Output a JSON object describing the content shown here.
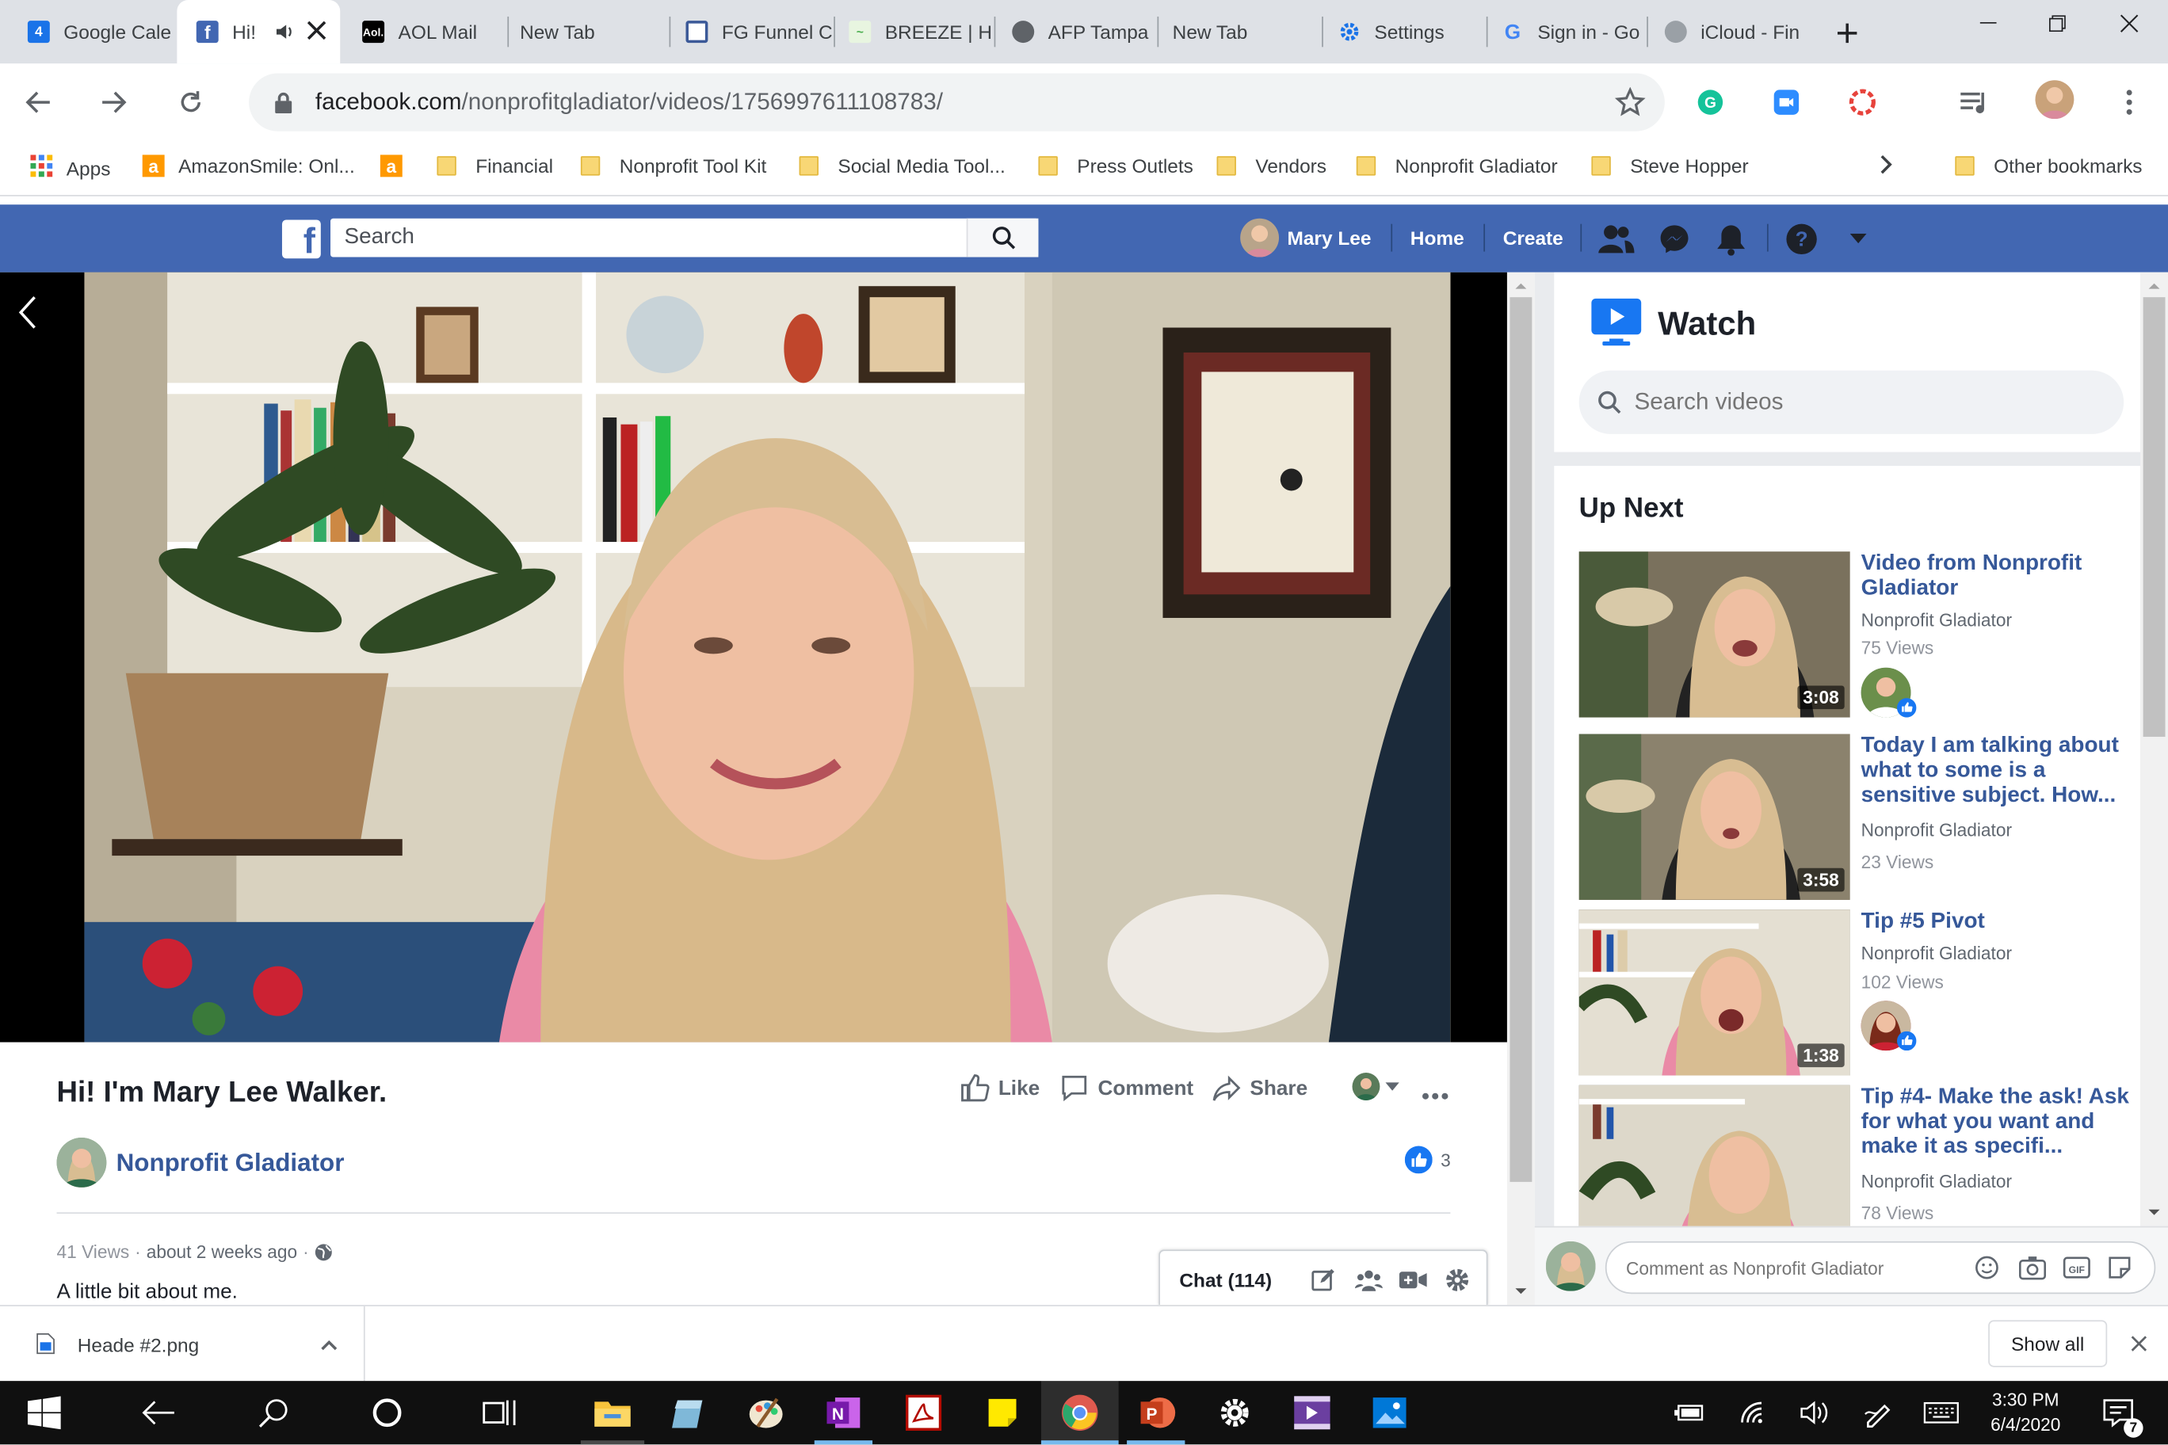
{
  "browser": {
    "tabs": [
      {
        "title": "Google Cale",
        "favicon": "google-calendar-icon"
      },
      {
        "title": "Hi!",
        "favicon": "facebook-icon",
        "active": true
      },
      {
        "title": "AOL Mail",
        "favicon": "aol-icon"
      },
      {
        "title": "New Tab",
        "favicon": ""
      },
      {
        "title": "FG Funnel C",
        "favicon": "funnel-icon"
      },
      {
        "title": "BREEZE | Hc",
        "favicon": "breeze-icon"
      },
      {
        "title": "AFP Tampa",
        "favicon": "globe-icon"
      },
      {
        "title": "New Tab",
        "favicon": ""
      },
      {
        "title": "Settings",
        "favicon": "gear-icon"
      },
      {
        "title": "Sign in - Go",
        "favicon": "google-icon"
      },
      {
        "title": "iCloud - Fin",
        "favicon": "apple-icon"
      }
    ],
    "url_host": "facebook.com",
    "url_path": "/nonprofitgladiator/videos/1756997611108783/",
    "bookmarks": [
      {
        "label": "Apps"
      },
      {
        "label": "AmazonSmile: Onl..."
      },
      {
        "label": ""
      },
      {
        "label": "Financial"
      },
      {
        "label": "Nonprofit Tool Kit"
      },
      {
        "label": "Social Media Tool..."
      },
      {
        "label": "Press Outlets"
      },
      {
        "label": "Vendors"
      },
      {
        "label": "Nonprofit Gladiator"
      },
      {
        "label": "Steve Hopper"
      }
    ],
    "other_bookmarks": "Other bookmarks"
  },
  "facebook": {
    "search_placeholder": "Search",
    "user_name": "Mary Lee",
    "nav_home": "Home",
    "nav_create": "Create"
  },
  "video": {
    "title": "Hi! I'm Mary Lee Walker.",
    "page_name": "Nonprofit Gladiator",
    "like_label": "Like",
    "comment_label": "Comment",
    "share_label": "Share",
    "reaction_count": "3",
    "views": "41 Views",
    "time_ago": "about 2 weeks ago",
    "separator": "·",
    "description": "A little bit about me.",
    "chat_label": "Chat (114)"
  },
  "watch": {
    "heading": "Watch",
    "search_placeholder": "Search videos",
    "up_next_heading": "Up Next",
    "items": [
      {
        "title": "Video from Nonprofit Gladiator",
        "channel": "Nonprofit Gladiator",
        "views": "75 Views",
        "duration": "3:08"
      },
      {
        "title": "Today I am talking about what to some is a sensitive subject. How...",
        "channel": "Nonprofit Gladiator",
        "views": "23 Views",
        "duration": "3:58"
      },
      {
        "title": "Tip #5 Pivot",
        "channel": "Nonprofit Gladiator",
        "views": "102 Views",
        "duration": "1:38"
      },
      {
        "title": "Tip #4- Make the ask! Ask for what you want and make it as specifi...",
        "channel": "Nonprofit Gladiator",
        "views": "78 Views",
        "duration": ""
      }
    ],
    "comment_placeholder": "Comment as Nonprofit Gladiator"
  },
  "downloads": {
    "file_name": "Heade #2.png",
    "show_all": "Show all"
  },
  "taskbar": {
    "time": "3:30 PM",
    "date": "6/4/2020",
    "notification_count": "7"
  },
  "colors": {
    "facebook_blue": "#4267b2",
    "link_blue": "#365899",
    "chrome_tabstrip": "#dee1e6",
    "taskbar": "#101010"
  }
}
